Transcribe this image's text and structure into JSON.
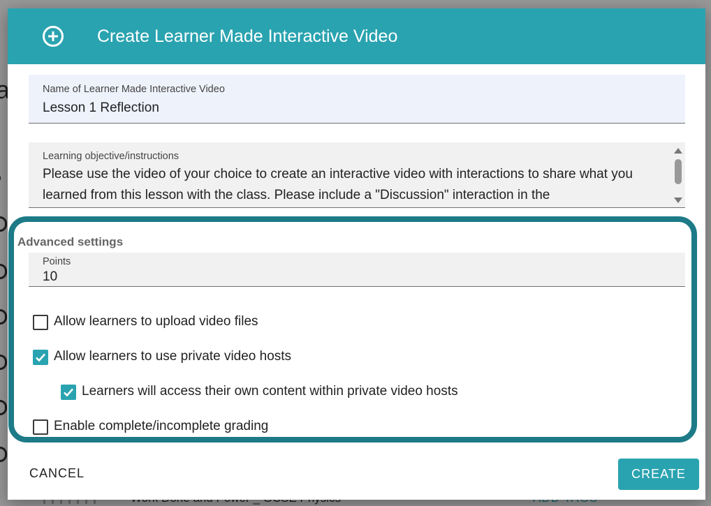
{
  "background": {
    "title_fragment": "a",
    "label_fragment": "o",
    "bottom_row_text": "Work Done and Power _ GCSE Physics",
    "bottom_row_action": "ADD TAGS"
  },
  "dialog": {
    "header_icon": "add-circle-icon",
    "title": "Create Learner Made Interactive Video",
    "accent_color": "#2aa3b0",
    "name_field": {
      "label": "Name of Learner Made Interactive Video",
      "value": "Lesson 1 Reflection"
    },
    "objective_field": {
      "label": "Learning objective/instructions",
      "value": "Please use the video of your choice to create an interactive video with interactions to share what you learned from this lesson with the class. Please include a \"Discussion\" interaction in the"
    },
    "advanced": {
      "title": "Advanced settings",
      "highlight_color": "#1d7a87",
      "points": {
        "label": "Points",
        "value": "10"
      },
      "options": [
        {
          "label": "Allow learners to upload video files",
          "checked": false
        },
        {
          "label": "Allow learners to use private video hosts",
          "checked": true
        },
        {
          "label": "Learners will access their own content within private video hosts",
          "checked": true
        },
        {
          "label": "Enable complete/incomplete grading",
          "checked": false
        }
      ]
    },
    "actions": {
      "cancel_label": "CANCEL",
      "create_label": "CREATE"
    }
  }
}
